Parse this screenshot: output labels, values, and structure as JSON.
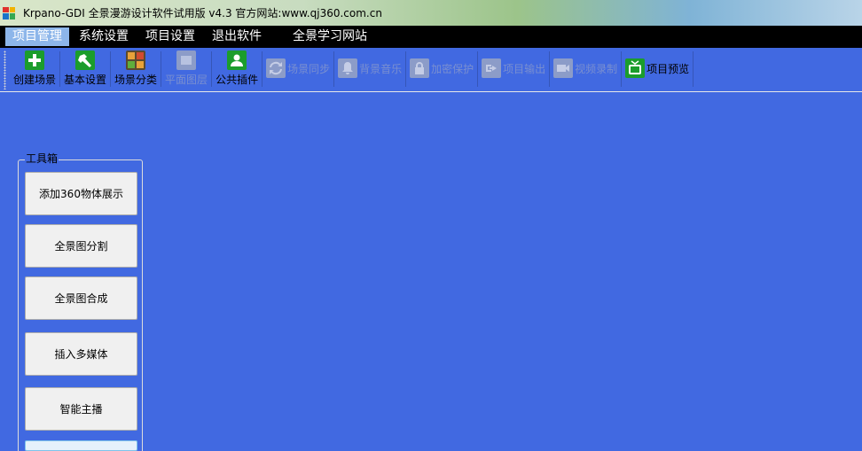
{
  "window": {
    "title": "Krpano-GDI 全景漫游设计软件试用版 v4.3  官方网站:www.qj360.com.cn",
    "icon": "app-icon"
  },
  "menu": {
    "items": [
      {
        "label": "项目管理",
        "active": true
      },
      {
        "label": "系统设置",
        "active": false
      },
      {
        "label": "项目设置",
        "active": false
      },
      {
        "label": "退出软件",
        "active": false
      },
      {
        "label": "全景学习网站",
        "active": false
      }
    ]
  },
  "toolbar": {
    "buttons": [
      {
        "label": "创建场景",
        "icon": "plus-icon",
        "enabled": true
      },
      {
        "label": "基本设置",
        "icon": "hammer-icon",
        "enabled": true
      },
      {
        "label": "场景分类",
        "icon": "grid-icon",
        "enabled": true
      },
      {
        "label": "平面图层",
        "icon": "layer-icon",
        "enabled": false
      },
      {
        "label": "公共插件",
        "icon": "user-icon",
        "enabled": true
      },
      {
        "label": "场景同步",
        "icon": "sync-icon",
        "enabled": false
      },
      {
        "label": "背景音乐",
        "icon": "bell-icon",
        "enabled": false
      },
      {
        "label": "加密保护",
        "icon": "lock-icon",
        "enabled": false
      },
      {
        "label": "项目输出",
        "icon": "export-icon",
        "enabled": false
      },
      {
        "label": "视频录制",
        "icon": "video-icon",
        "enabled": false
      },
      {
        "label": "项目预览",
        "icon": "tv-icon",
        "enabled": true
      }
    ]
  },
  "toolbox": {
    "legend": "工具箱",
    "buttons": [
      {
        "label": "添加360物体展示"
      },
      {
        "label": "全景图分割"
      },
      {
        "label": "全景图合成"
      },
      {
        "label": "插入多媒体"
      },
      {
        "label": "智能主播"
      },
      {
        "label": ""
      }
    ]
  },
  "colors": {
    "background": "#4169e1",
    "menubar": "#000000",
    "menu_active": "#8db6ea",
    "icon_green": "#1b9d2c"
  }
}
